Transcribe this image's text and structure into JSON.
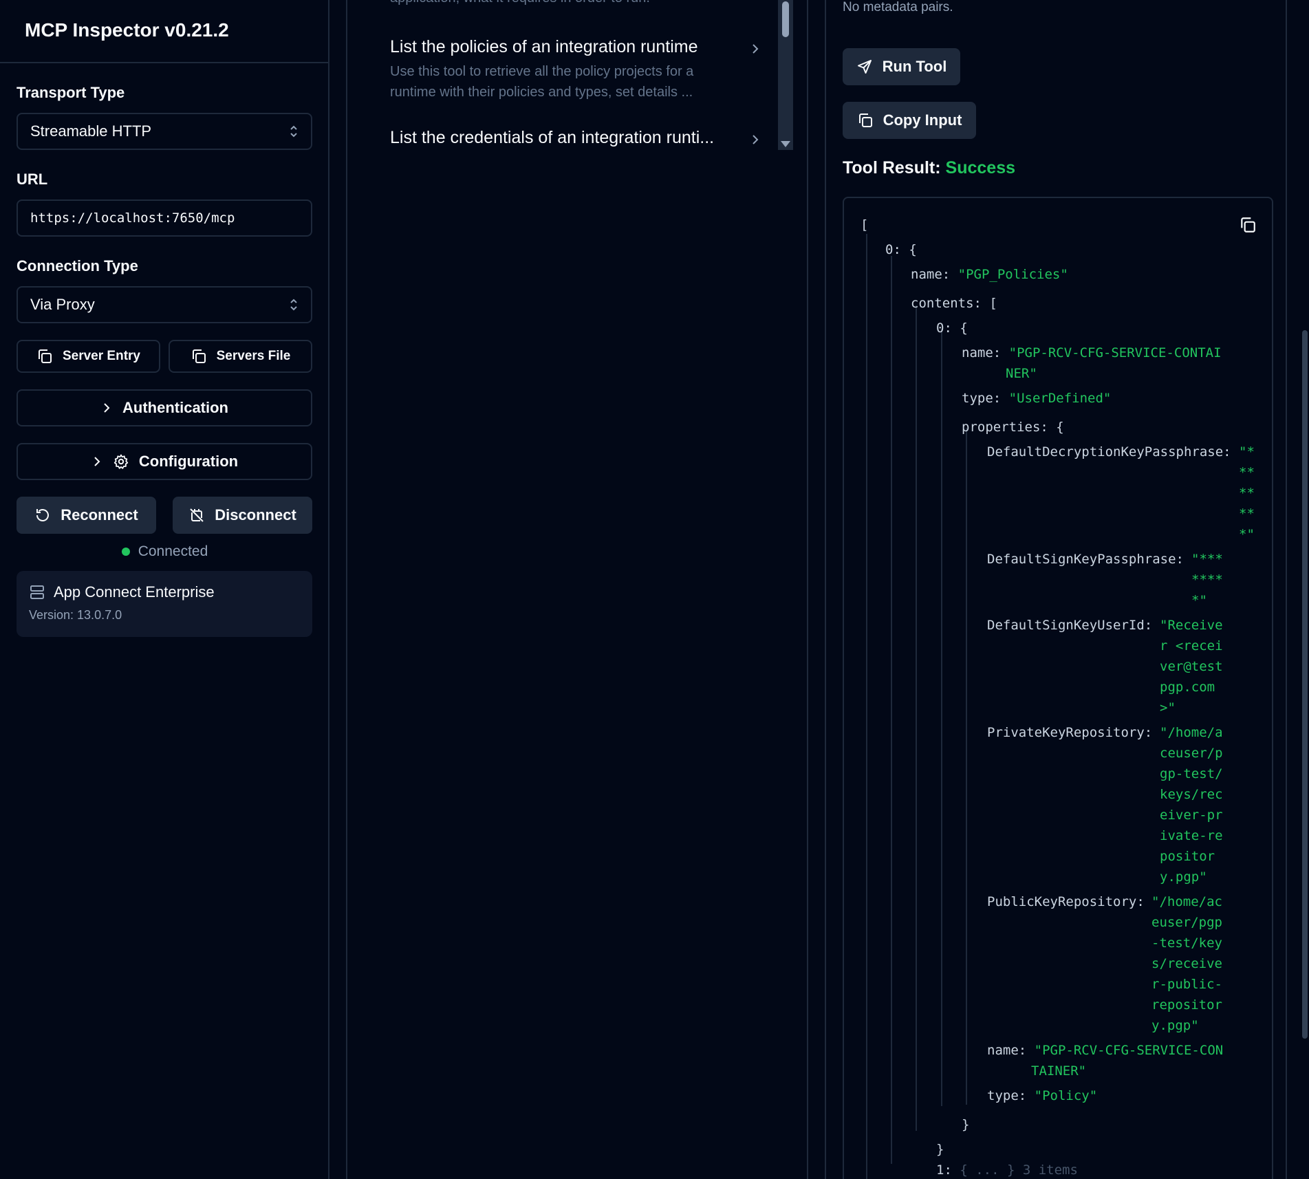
{
  "sidebar": {
    "title": "MCP Inspector v0.21.2",
    "transport_label": "Transport Type",
    "transport_value": "Streamable HTTP",
    "url_label": "URL",
    "url_value": "https://localhost:7650/mcp",
    "connection_label": "Connection Type",
    "connection_value": "Via Proxy",
    "server_entry": "Server Entry",
    "servers_file": "Servers File",
    "authentication": "Authentication",
    "configuration": "Configuration",
    "reconnect": "Reconnect",
    "disconnect": "Disconnect",
    "status": "Connected",
    "server_name": "App Connect Enterprise",
    "server_version": "Version: 13.0.7.0"
  },
  "tools": {
    "faded_text": "application, what it requires in order to run.",
    "items": [
      {
        "title": "List the policies of an integration runtime",
        "desc_line1": "Use this tool to retrieve all the policy projects for a",
        "desc_line2": "runtime with their policies and types, set details ..."
      },
      {
        "title": "List the credentials of an integration runti..."
      }
    ]
  },
  "detail": {
    "metadata_text": "No metadata pairs.",
    "run_tool": "Run Tool",
    "copy_input": "Copy Input",
    "result_label": "Tool Result:",
    "result_status": "Success",
    "json": {
      "open_bracket": "[",
      "idx0": "0:",
      "brace": "{",
      "name_key": "name:",
      "name_val": "\"PGP_Policies\"",
      "contents_key": "contents:",
      "contents_open": "[",
      "c_idx0": "0:",
      "c_brace": "{",
      "c_name_key": "name:",
      "c_name_val_1": "\"PGP-RCV-CFG-SERVICE-CONTAI",
      "c_name_val_2": "NER\"",
      "c_type_key": "type:",
      "c_type_val": "\"UserDefined\"",
      "props_key": "properties:",
      "props_brace": "{",
      "p1_key": "DefaultDecryptionKeyPassphrase:",
      "p1_val": [
        "\"*",
        "**",
        "**",
        "**",
        "*\""
      ],
      "p2_key": "DefaultSignKeyPassphrase:",
      "p2_val": [
        "\"***",
        "****",
        "*\""
      ],
      "p3_key": "DefaultSignKeyUserId:",
      "p3_val": [
        "\"Receive",
        "r <recei",
        "ver@test",
        "pgp.com",
        ">\""
      ],
      "p4_key": "PrivateKeyRepository:",
      "p4_val": [
        "\"/home/a",
        "ceuser/p",
        "gp-test/",
        "keys/rec",
        "eiver-pr",
        "ivate-re",
        "positor",
        "y.pgp\""
      ],
      "p5_key": "PublicKeyRepository:",
      "p5_val": [
        "\"/home/ac",
        "euser/pgp",
        "-test/key",
        "s/receive",
        "r-public-",
        "repositor",
        "y.pgp\""
      ],
      "p6_key": "name:",
      "p6_val_1": "\"PGP-RCV-CFG-SERVICE-CON",
      "p6_val_2": "TAINER\"",
      "p7_key": "type:",
      "p7_val": "\"Policy\"",
      "close_inner": "}",
      "close_outer": "}",
      "next_idx": "1:",
      "next_summary": "{ ... } 3 items"
    }
  },
  "colors": {
    "background": "#020817",
    "border": "#1e293b",
    "success": "#22c55e",
    "string": "#22c55e",
    "muted": "#94a3b8"
  }
}
